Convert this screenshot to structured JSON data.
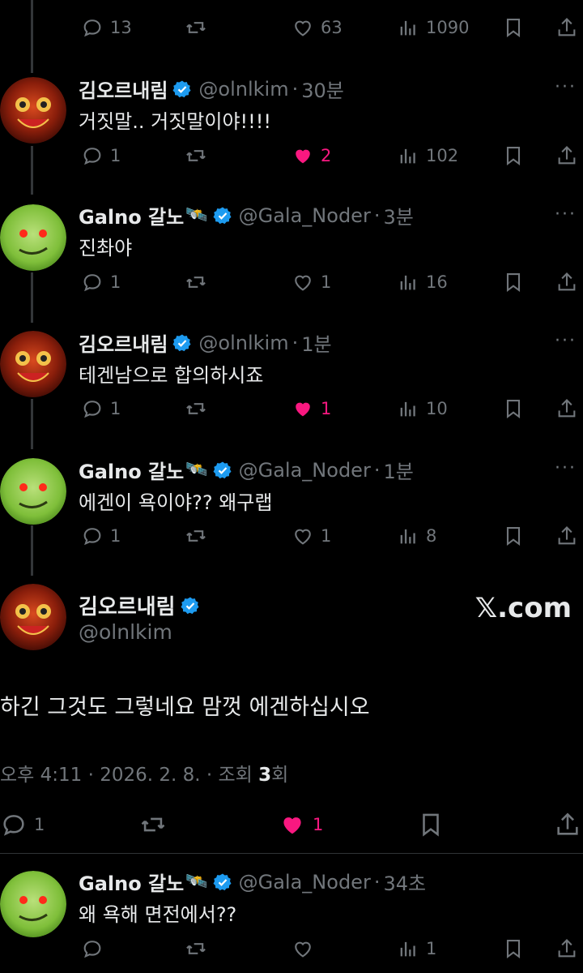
{
  "colors": {
    "background": "#000000",
    "text": "#e7e9ea",
    "muted": "#71767b",
    "like": "#f91880",
    "verified": "#1d9bf0"
  },
  "top_actions": {
    "replies": "13",
    "retweets": "",
    "likes": "63",
    "views": "1090"
  },
  "tweets": [
    {
      "name": "김오르내림",
      "handle": "@olnlkim",
      "sep": "·",
      "time": "30분",
      "text": "거짓말.. 거짓말이야!!!!",
      "replies": "1",
      "likes": "2",
      "liked": true,
      "views": "102"
    },
    {
      "name": "Galno 갈노",
      "badge": "🛰️",
      "handle": "@Gala_Noder",
      "sep": "·",
      "time": "3분",
      "text": "진촤야",
      "replies": "1",
      "likes": "1",
      "liked": false,
      "views": "16"
    },
    {
      "name": "김오르내림",
      "handle": "@olnlkim",
      "sep": "·",
      "time": "1분",
      "text": "테겐남으로 합의하시죠",
      "replies": "1",
      "likes": "1",
      "liked": true,
      "views": "10"
    },
    {
      "name": "Galno 갈노",
      "badge": "🛰️",
      "handle": "@Gala_Noder",
      "sep": "·",
      "time": "1분",
      "text": "에겐이 욕이야?? 왜구랩",
      "replies": "1",
      "likes": "1",
      "liked": false,
      "views": "8"
    }
  ],
  "focused": {
    "name": "김오르내림",
    "handle": "@olnlkim",
    "site": "𝕏.com",
    "text": "하긴 그것도 그렇네요 맘껏 에겐하십시오",
    "time_date": "오후 4:11 · 2026. 2. 8. · 조회 ",
    "views": "3",
    "views_suffix": "회",
    "replies": "1",
    "likes": "1"
  },
  "last_tweet": {
    "name": "Galno 갈노",
    "badge": "🛰️",
    "handle": "@Gala_Noder",
    "sep": "·",
    "time": "34초",
    "text": "왜 욕해 면전에서??",
    "views": "1"
  },
  "more_label": "···"
}
